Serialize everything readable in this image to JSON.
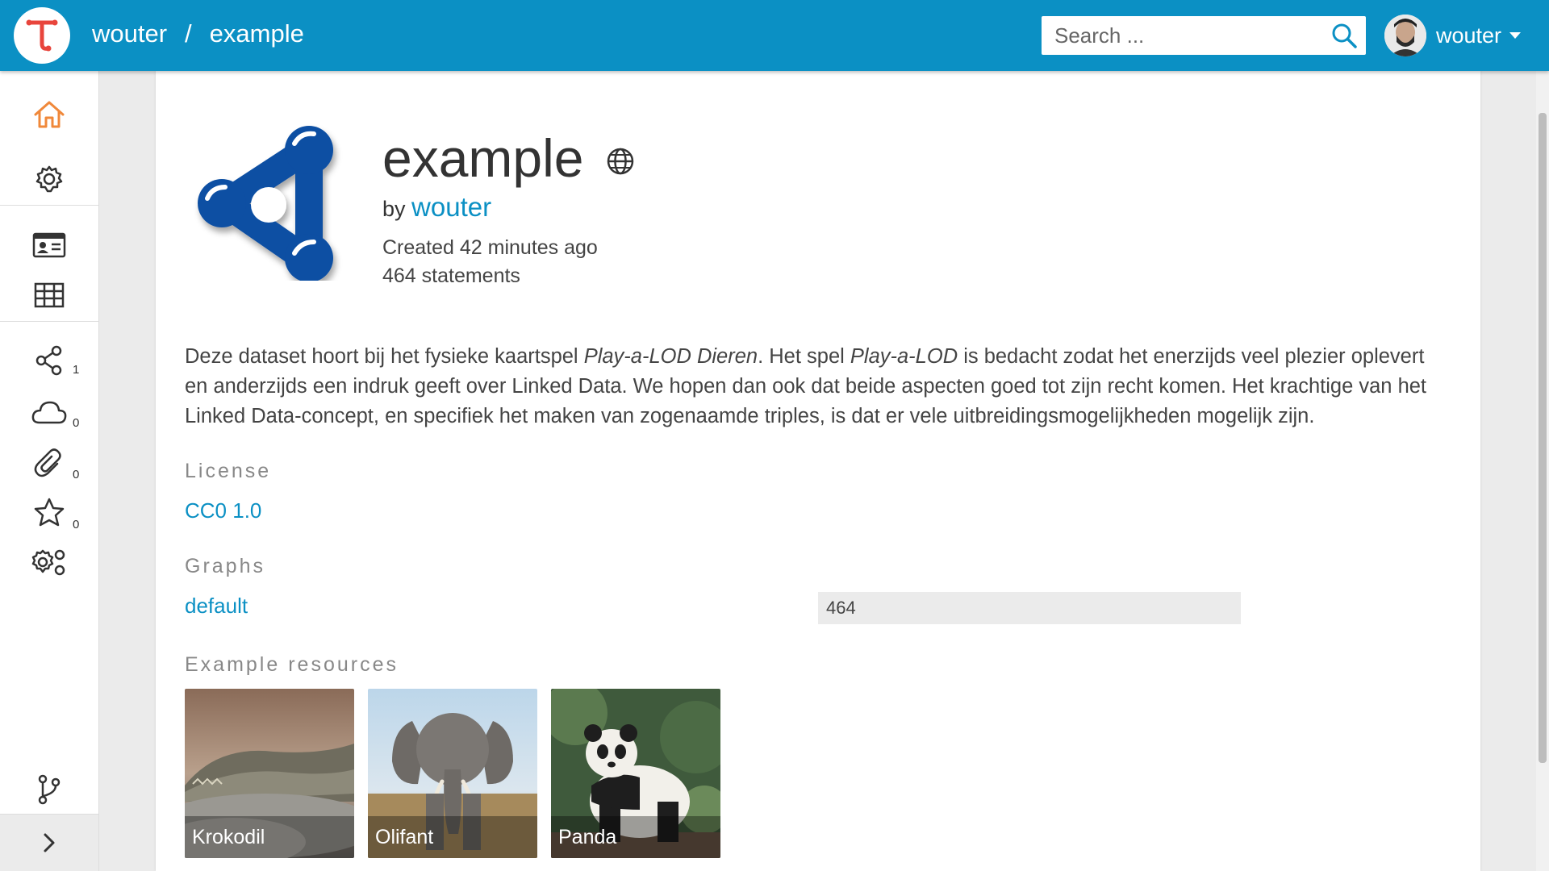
{
  "header": {
    "crumb_owner": "wouter",
    "crumb_separator": "/",
    "crumb_dataset": "example",
    "search_placeholder": "Search ...",
    "user_name": "wouter"
  },
  "sidebar": {
    "items": [
      {
        "icon": "home-icon",
        "active": true
      },
      {
        "icon": "gear-icon"
      },
      {
        "icon": "id-card-icon"
      },
      {
        "icon": "table-icon"
      },
      {
        "icon": "share-icon",
        "count": "1"
      },
      {
        "icon": "cloud-icon",
        "count": "0"
      },
      {
        "icon": "paperclip-icon",
        "count": "0"
      },
      {
        "icon": "star-icon",
        "count": "0"
      },
      {
        "icon": "gears-icon"
      },
      {
        "icon": "branch-icon"
      }
    ],
    "toggle_icon": "chevron-right-icon"
  },
  "dataset": {
    "title": "example",
    "by_label": "by",
    "owner": "wouter",
    "created": "Created 42 minutes ago",
    "statements": "464 statements",
    "description_parts": {
      "p1": "Deze dataset hoort bij het fysieke kaartspel ",
      "em1": "Play-a-LOD Dieren",
      "p2": ". Het spel ",
      "em2": "Play-a-LOD",
      "p3": " is bedacht zodat het enerzijds veel plezier oplevert en anderzijds een indruk geeft over Linked Data. We hopen dan ook dat beide aspecten goed tot zijn recht komen. Het krachtige van het Linked Data-concept, en specifiek het maken van zogenaamde triples, is dat er vele uitbreidingsmogelijkheden mogelijk zijn."
    },
    "license_heading": "License",
    "license": "CC0 1.0",
    "graphs_heading": "Graphs",
    "graph_name": "default",
    "graph_count": "464",
    "examples_heading": "Example resources",
    "examples": [
      {
        "label": "Krokodil"
      },
      {
        "label": "Olifant"
      },
      {
        "label": "Panda"
      }
    ]
  },
  "colors": {
    "primary": "#0b90c4",
    "active_icon": "#f0883a",
    "logo_red": "#e8453c"
  }
}
